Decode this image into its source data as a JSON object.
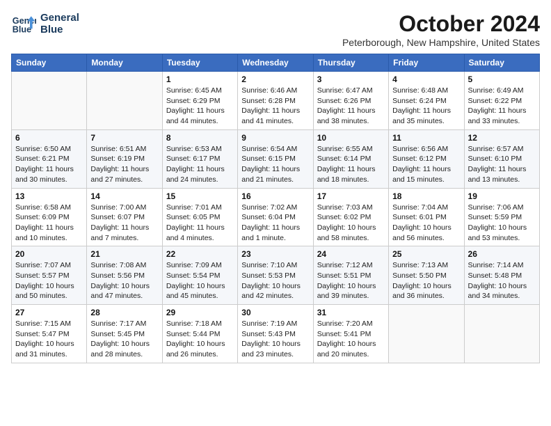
{
  "header": {
    "logo_line1": "General",
    "logo_line2": "Blue",
    "month_year": "October 2024",
    "location": "Peterborough, New Hampshire, United States"
  },
  "days_of_week": [
    "Sunday",
    "Monday",
    "Tuesday",
    "Wednesday",
    "Thursday",
    "Friday",
    "Saturday"
  ],
  "weeks": [
    [
      {
        "day": "",
        "info": ""
      },
      {
        "day": "",
        "info": ""
      },
      {
        "day": "1",
        "info": "Sunrise: 6:45 AM\nSunset: 6:29 PM\nDaylight: 11 hours and 44 minutes."
      },
      {
        "day": "2",
        "info": "Sunrise: 6:46 AM\nSunset: 6:28 PM\nDaylight: 11 hours and 41 minutes."
      },
      {
        "day": "3",
        "info": "Sunrise: 6:47 AM\nSunset: 6:26 PM\nDaylight: 11 hours and 38 minutes."
      },
      {
        "day": "4",
        "info": "Sunrise: 6:48 AM\nSunset: 6:24 PM\nDaylight: 11 hours and 35 minutes."
      },
      {
        "day": "5",
        "info": "Sunrise: 6:49 AM\nSunset: 6:22 PM\nDaylight: 11 hours and 33 minutes."
      }
    ],
    [
      {
        "day": "6",
        "info": "Sunrise: 6:50 AM\nSunset: 6:21 PM\nDaylight: 11 hours and 30 minutes."
      },
      {
        "day": "7",
        "info": "Sunrise: 6:51 AM\nSunset: 6:19 PM\nDaylight: 11 hours and 27 minutes."
      },
      {
        "day": "8",
        "info": "Sunrise: 6:53 AM\nSunset: 6:17 PM\nDaylight: 11 hours and 24 minutes."
      },
      {
        "day": "9",
        "info": "Sunrise: 6:54 AM\nSunset: 6:15 PM\nDaylight: 11 hours and 21 minutes."
      },
      {
        "day": "10",
        "info": "Sunrise: 6:55 AM\nSunset: 6:14 PM\nDaylight: 11 hours and 18 minutes."
      },
      {
        "day": "11",
        "info": "Sunrise: 6:56 AM\nSunset: 6:12 PM\nDaylight: 11 hours and 15 minutes."
      },
      {
        "day": "12",
        "info": "Sunrise: 6:57 AM\nSunset: 6:10 PM\nDaylight: 11 hours and 13 minutes."
      }
    ],
    [
      {
        "day": "13",
        "info": "Sunrise: 6:58 AM\nSunset: 6:09 PM\nDaylight: 11 hours and 10 minutes."
      },
      {
        "day": "14",
        "info": "Sunrise: 7:00 AM\nSunset: 6:07 PM\nDaylight: 11 hours and 7 minutes."
      },
      {
        "day": "15",
        "info": "Sunrise: 7:01 AM\nSunset: 6:05 PM\nDaylight: 11 hours and 4 minutes."
      },
      {
        "day": "16",
        "info": "Sunrise: 7:02 AM\nSunset: 6:04 PM\nDaylight: 11 hours and 1 minute."
      },
      {
        "day": "17",
        "info": "Sunrise: 7:03 AM\nSunset: 6:02 PM\nDaylight: 10 hours and 58 minutes."
      },
      {
        "day": "18",
        "info": "Sunrise: 7:04 AM\nSunset: 6:01 PM\nDaylight: 10 hours and 56 minutes."
      },
      {
        "day": "19",
        "info": "Sunrise: 7:06 AM\nSunset: 5:59 PM\nDaylight: 10 hours and 53 minutes."
      }
    ],
    [
      {
        "day": "20",
        "info": "Sunrise: 7:07 AM\nSunset: 5:57 PM\nDaylight: 10 hours and 50 minutes."
      },
      {
        "day": "21",
        "info": "Sunrise: 7:08 AM\nSunset: 5:56 PM\nDaylight: 10 hours and 47 minutes."
      },
      {
        "day": "22",
        "info": "Sunrise: 7:09 AM\nSunset: 5:54 PM\nDaylight: 10 hours and 45 minutes."
      },
      {
        "day": "23",
        "info": "Sunrise: 7:10 AM\nSunset: 5:53 PM\nDaylight: 10 hours and 42 minutes."
      },
      {
        "day": "24",
        "info": "Sunrise: 7:12 AM\nSunset: 5:51 PM\nDaylight: 10 hours and 39 minutes."
      },
      {
        "day": "25",
        "info": "Sunrise: 7:13 AM\nSunset: 5:50 PM\nDaylight: 10 hours and 36 minutes."
      },
      {
        "day": "26",
        "info": "Sunrise: 7:14 AM\nSunset: 5:48 PM\nDaylight: 10 hours and 34 minutes."
      }
    ],
    [
      {
        "day": "27",
        "info": "Sunrise: 7:15 AM\nSunset: 5:47 PM\nDaylight: 10 hours and 31 minutes."
      },
      {
        "day": "28",
        "info": "Sunrise: 7:17 AM\nSunset: 5:45 PM\nDaylight: 10 hours and 28 minutes."
      },
      {
        "day": "29",
        "info": "Sunrise: 7:18 AM\nSunset: 5:44 PM\nDaylight: 10 hours and 26 minutes."
      },
      {
        "day": "30",
        "info": "Sunrise: 7:19 AM\nSunset: 5:43 PM\nDaylight: 10 hours and 23 minutes."
      },
      {
        "day": "31",
        "info": "Sunrise: 7:20 AM\nSunset: 5:41 PM\nDaylight: 10 hours and 20 minutes."
      },
      {
        "day": "",
        "info": ""
      },
      {
        "day": "",
        "info": ""
      }
    ]
  ]
}
